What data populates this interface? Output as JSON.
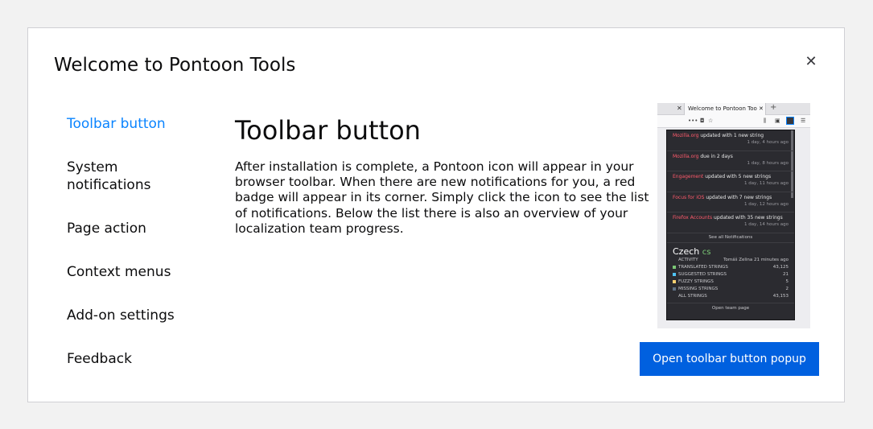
{
  "dialog": {
    "title": "Welcome to Pontoon Tools",
    "close_icon": "✕"
  },
  "nav": {
    "items": [
      {
        "label": "Toolbar button",
        "active": true
      },
      {
        "label": "System notifications",
        "active": false
      },
      {
        "label": "Page action",
        "active": false
      },
      {
        "label": "Context menus",
        "active": false
      },
      {
        "label": "Add-on settings",
        "active": false
      },
      {
        "label": "Feedback",
        "active": false
      }
    ]
  },
  "content": {
    "title": "Toolbar button",
    "text": "After installation is complete, a Pontoon icon will appear in your browser toolbar. When there are new notifications for you, a red badge will appear in its corner. Simply click the icon to see the list of notifications. Below the list there is also an overview of your localization team progress.",
    "button_label": "Open toolbar button popup"
  },
  "preview": {
    "tab_title": "Welcome to Pontoon Too",
    "notifications": [
      {
        "project": "Mozilla.org",
        "text": " updated with 1 new string",
        "time": "1 day, 4 hours ago"
      },
      {
        "project": "Mozilla.org",
        "text": " due in 2 days",
        "time": "1 day, 8 hours ago"
      },
      {
        "project": "Engagement",
        "text": " updated with 5 new strings",
        "time": "1 day, 11 hours ago"
      },
      {
        "project": "Focus for iOS",
        "text": " updated with 7 new strings",
        "time": "1 day, 12 hours ago"
      },
      {
        "project": "Firefox Accounts",
        "text": " updated with 35 new strings",
        "time": "1 day, 14 hours ago"
      }
    ],
    "see_all": "See all Notifications",
    "team_name": "Czech",
    "team_code": "cs",
    "activity_label": "ACTIVITY",
    "activity_value": "Tomáš Zelina 21 minutes ago",
    "stats": [
      {
        "label": "TRANSLATED STRINGS",
        "value": "43,125",
        "color": "#7bc876"
      },
      {
        "label": "SUGGESTED STRINGS",
        "value": "21",
        "color": "#4fc4f6"
      },
      {
        "label": "FUZZY STRINGS",
        "value": "5",
        "color": "#fed271"
      },
      {
        "label": "MISSING STRINGS",
        "value": "2",
        "color": "#5f7285"
      },
      {
        "label": "ALL STRINGS",
        "value": "43,153",
        "color": ""
      }
    ],
    "open_team": "Open team page"
  },
  "colors": {
    "accent": "#0a84ff",
    "primary_button": "#0060df"
  }
}
